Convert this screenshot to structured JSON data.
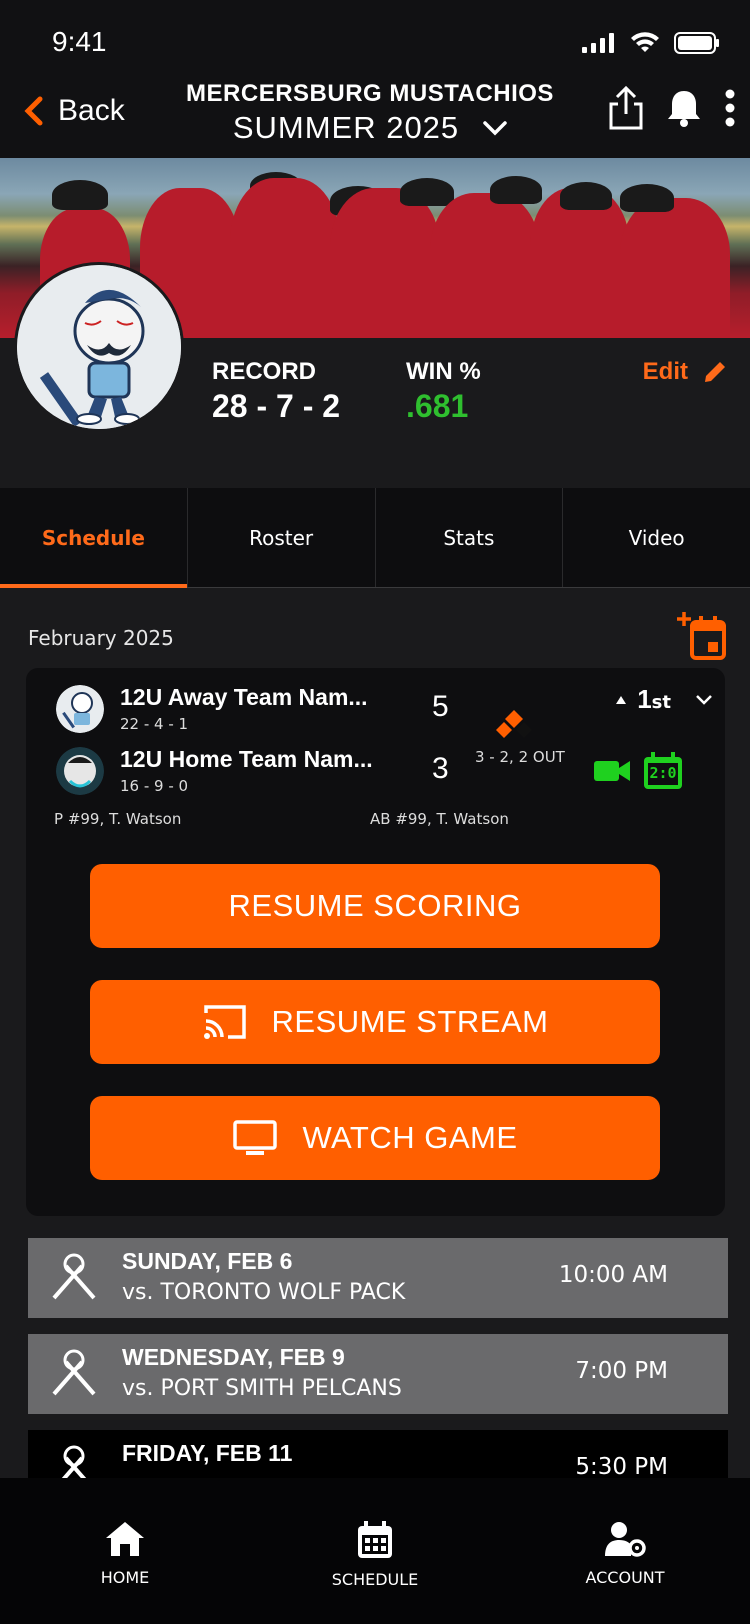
{
  "status_bar": {
    "time": "9:41"
  },
  "nav": {
    "back_label": "Back",
    "team_name": "MERCERSBURG MUSTACHIOS",
    "season": "SUMMER 2025"
  },
  "team_info": {
    "record_label": "RECORD",
    "record_value": "28 - 7 - 2",
    "win_label": "WIN %",
    "win_value": ".681",
    "edit_label": "Edit"
  },
  "tabs": [
    {
      "label": "Schedule",
      "active": true
    },
    {
      "label": "Roster",
      "active": false
    },
    {
      "label": "Stats",
      "active": false
    },
    {
      "label": "Video",
      "active": false
    }
  ],
  "schedule": {
    "month": "February 2025",
    "live_game": {
      "away": {
        "name": "12U Away Team Nam...",
        "record": "22 - 4 - 1",
        "score": "5"
      },
      "home": {
        "name": "12U Home Team Nam...",
        "record": "16 - 9 - 0",
        "score": "3"
      },
      "inning_number": "1",
      "inning_suffix": "st",
      "count": "3 - 2, 2 OUT",
      "pitcher": "P #99, T. Watson",
      "batter": "AB #99, T. Watson",
      "scoreboard_text": "2:0",
      "buttons": {
        "resume_scoring": "RESUME SCORING",
        "resume_stream": "RESUME STREAM",
        "watch_game": "WATCH GAME"
      }
    },
    "games": [
      {
        "day": "SUNDAY, FEB 6",
        "opponent": "vs. TORONTO WOLF PACK",
        "time": "10:00 AM"
      },
      {
        "day": "WEDNESDAY, FEB 9",
        "opponent": "vs. PORT SMITH PELCANS",
        "time": "7:00 PM"
      },
      {
        "day": "FRIDAY, FEB 11",
        "opponent": "",
        "time": "5:30 PM"
      }
    ]
  },
  "bottom_nav": [
    {
      "label": "HOME",
      "icon": "home-icon"
    },
    {
      "label": "SCHEDULE",
      "icon": "calendar-icon"
    },
    {
      "label": "ACCOUNT",
      "icon": "account-settings-icon"
    }
  ],
  "colors": {
    "accent": "#ff5f00",
    "win_green": "#2fbf2f",
    "background": "#1a1a1c"
  }
}
